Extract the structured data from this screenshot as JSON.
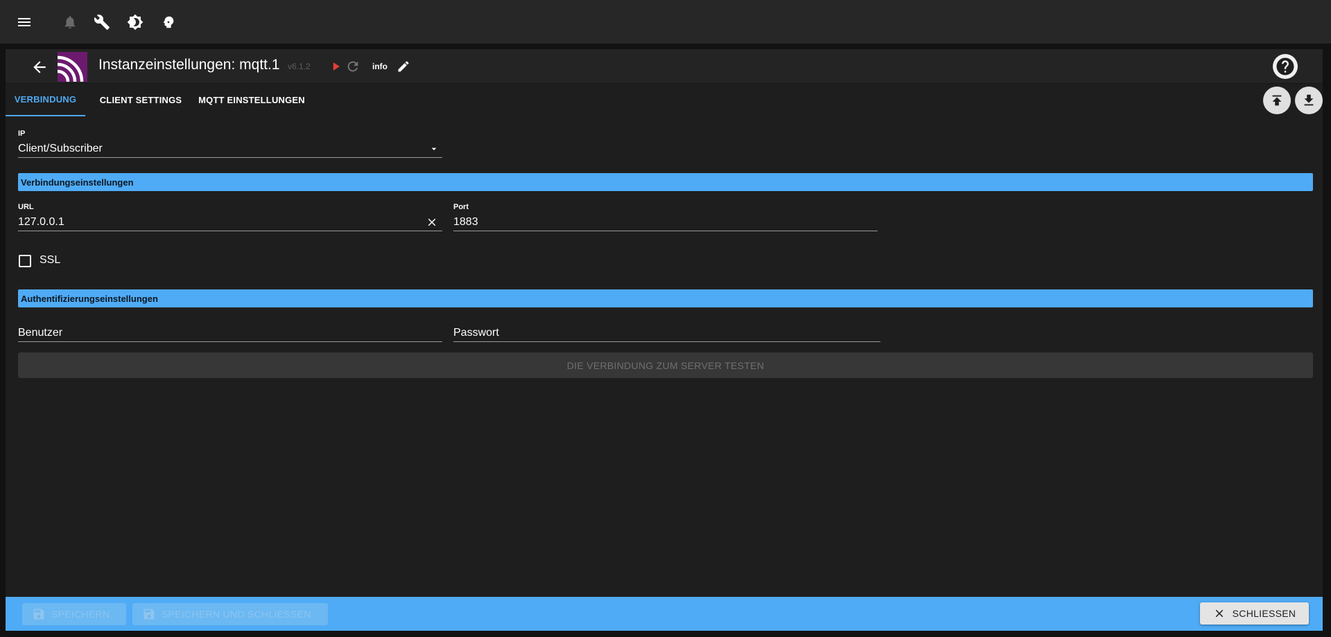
{
  "topbar": {
    "icons": [
      "menu-icon",
      "bell-icon",
      "wrench-icon",
      "brightness-icon",
      "expert-mode-icon"
    ]
  },
  "header": {
    "title": "Instanzeinstellungen: mqtt.1",
    "version": "v6.1.2",
    "info_label": "info"
  },
  "tabs": [
    {
      "label": "VERBINDUNG",
      "active": true
    },
    {
      "label": "CLIENT SETTINGS",
      "active": false
    },
    {
      "label": "MQTT EINSTELLUNGEN",
      "active": false
    }
  ],
  "form": {
    "ip_label": "IP",
    "ip_value": "Client/Subscriber",
    "section_connection": "Verbindungseinstellungen",
    "url_label": "URL",
    "url_value": "127.0.0.1",
    "port_label": "Port",
    "port_value": "1883",
    "ssl_label": "SSL",
    "ssl_checked": false,
    "section_auth": "Authentifizierungseinstellungen",
    "user_placeholder": "Benutzer",
    "password_placeholder": "Passwort",
    "test_button": "DIE VERBINDUNG ZUM SERVER TESTEN"
  },
  "footer": {
    "save_label": "SPEICHERN",
    "save_close_label": "SPEICHERN UND SCHLIESSEN",
    "close_label": "SCHLIESSEN"
  },
  "colors": {
    "accent": "#4fabf5",
    "tab_active": "#4fa8f0",
    "play": "#e0403a",
    "logo": "#6c1a6e"
  }
}
